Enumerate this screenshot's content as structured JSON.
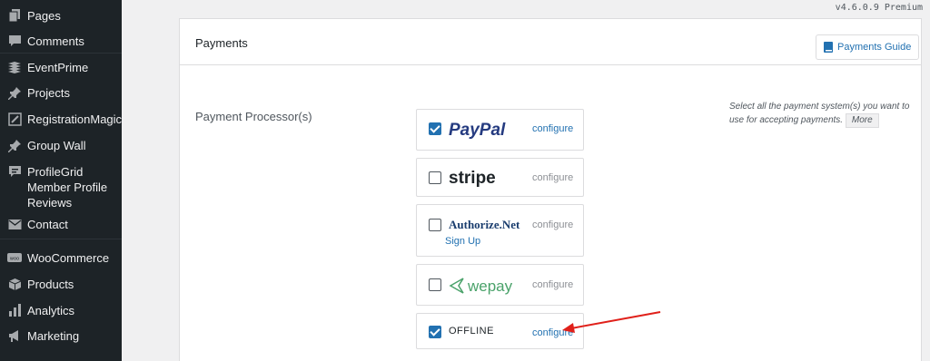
{
  "sidebar": {
    "items": [
      {
        "label": "Pages",
        "icon": "pages-icon"
      },
      {
        "label": "Comments",
        "icon": "comments-icon"
      },
      {
        "label": "EventPrime",
        "icon": "eventprime-icon"
      },
      {
        "label": "Projects",
        "icon": "pin-icon"
      },
      {
        "label": "RegistrationMagic",
        "icon": "registrationmagic-icon"
      },
      {
        "label": "Group Wall",
        "icon": "pin-icon"
      },
      {
        "label": "ProfileGrid Member Profile Reviews",
        "icon": "reviews-icon"
      },
      {
        "label": "Contact",
        "icon": "envelope-icon"
      },
      {
        "label": "WooCommerce",
        "icon": "woocommerce-icon"
      },
      {
        "label": "Products",
        "icon": "products-icon"
      },
      {
        "label": "Analytics",
        "icon": "analytics-icon"
      },
      {
        "label": "Marketing",
        "icon": "megaphone-icon"
      }
    ]
  },
  "version": "v4.6.0.9 Premium",
  "panel": {
    "title": "Payments",
    "guide_button": "Payments Guide",
    "field_label": "Payment Processor(s)",
    "help_text": "Select all the payment system(s) you want to use for accepting payments.",
    "more_button": "More"
  },
  "processors": [
    {
      "name": "PayPal",
      "checked": true,
      "configure": "configure"
    },
    {
      "name": "stripe",
      "checked": false,
      "configure": "configure"
    },
    {
      "name": "Authorize.Net",
      "checked": false,
      "configure": "configure",
      "sub_link": "Sign Up"
    },
    {
      "name": "wepay",
      "checked": false,
      "configure": "configure"
    },
    {
      "name": "OFFLINE",
      "checked": true,
      "configure": "configure"
    }
  ],
  "colors": {
    "sidebar_bg": "#1d2327",
    "accent": "#2271b1",
    "annotation_arrow": "#e0201a"
  }
}
